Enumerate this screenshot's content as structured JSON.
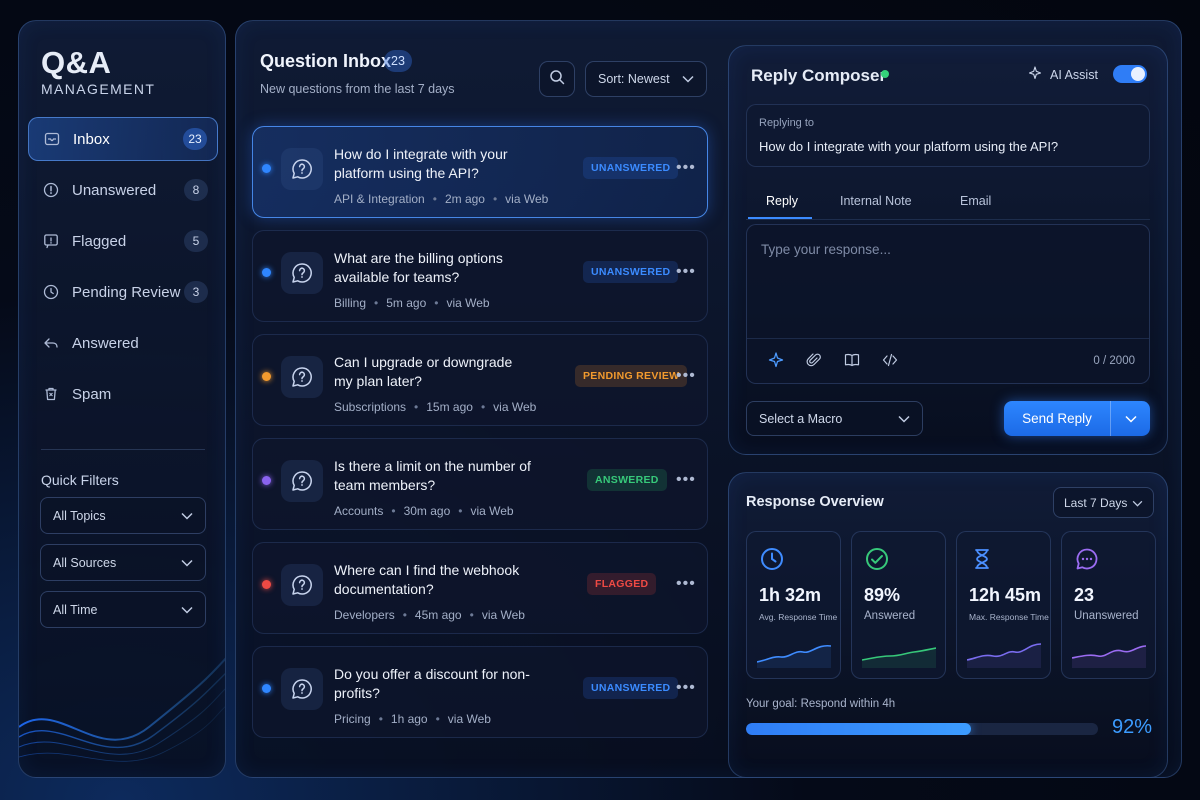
{
  "brand": {
    "title": "Q&A",
    "subtitle": "MANAGEMENT"
  },
  "sidebar": {
    "items": [
      {
        "label": "Inbox",
        "count": "23",
        "icon": "inbox-icon",
        "active": true
      },
      {
        "label": "Unanswered",
        "count": "8",
        "icon": "alert-circle-icon"
      },
      {
        "label": "Flagged",
        "count": "5",
        "icon": "flag-icon"
      },
      {
        "label": "Pending Review",
        "count": "3",
        "icon": "clock-icon"
      },
      {
        "label": "Answered",
        "count": "",
        "icon": "reply-icon"
      },
      {
        "label": "Spam",
        "count": "",
        "icon": "trash-icon"
      }
    ],
    "quick_filters_title": "Quick Filters",
    "filters": [
      "All Topics",
      "All Sources",
      "All Time"
    ]
  },
  "inbox": {
    "title": "Question Inbox",
    "count": "23",
    "subtitle": "New questions from the last 7 days",
    "sort_label": "Sort: Newest",
    "questions": [
      {
        "title": "How do I integrate with your platform using the API?",
        "topic": "API & Integration",
        "time": "2m ago",
        "source": "via Web",
        "status": "UNANSWERED",
        "dot_color": "#2f86ff",
        "selected": true
      },
      {
        "title": "What are the billing options available for teams?",
        "topic": "Billing",
        "time": "5m ago",
        "source": "via Web",
        "status": "UNANSWERED",
        "dot_color": "#2f86ff"
      },
      {
        "title": "Can I upgrade or downgrade my plan later?",
        "topic": "Subscriptions",
        "time": "15m ago",
        "source": "via Web",
        "status": "PENDING REVIEW",
        "dot_color": "#f29a2e"
      },
      {
        "title": "Is there a limit on the number of team members?",
        "topic": "Accounts",
        "time": "30m ago",
        "source": "via Web",
        "status": "ANSWERED",
        "dot_color": "#8a63f0"
      },
      {
        "title": "Where can I find the webhook documentation?",
        "topic": "Developers",
        "time": "45m ago",
        "source": "via Web",
        "status": "FLAGGED",
        "dot_color": "#ef4a44"
      },
      {
        "title": "Do you offer a discount for non-profits?",
        "topic": "Pricing",
        "time": "1h ago",
        "source": "via Web",
        "status": "UNANSWERED",
        "dot_color": "#2f86ff"
      }
    ]
  },
  "composer": {
    "title": "Reply Composer",
    "ai_assist_label": "AI Assist",
    "ai_assist_on": true,
    "replying_to_label": "Replying to",
    "replying_to_question": "How do I integrate with your platform using the API?",
    "tabs": [
      "Reply",
      "Internal Note",
      "Email"
    ],
    "placeholder": "Type your response...",
    "char_count": "0 / 2000",
    "macro_label": "Select a Macro",
    "send_label": "Send Reply"
  },
  "overview": {
    "title": "Response Overview",
    "range_label": "Last 7 Days",
    "stats": [
      {
        "value": "1h 32m",
        "label": "Avg. Response Time",
        "icon": "clock-icon",
        "color": "#3f8cff"
      },
      {
        "value": "89%",
        "label": "Answered",
        "icon": "check-circle-icon",
        "color": "#37c97a"
      },
      {
        "value": "12h 45m",
        "label": "Max. Response Time",
        "icon": "hourglass-icon",
        "color": "#4b8fff"
      },
      {
        "value": "23",
        "label": "Unanswered",
        "icon": "chat-bubble-icon",
        "color": "#9b6cf2"
      }
    ],
    "goal_label": "Your goal: Respond within 4h",
    "goal_percent": "92%",
    "goal_fraction": 0.64
  },
  "colors": {
    "accent": "#2f7df6",
    "unanswered": "#3b8bff",
    "pending": "#f29a2e",
    "answered": "#37c97a",
    "flagged": "#ef4a44"
  }
}
